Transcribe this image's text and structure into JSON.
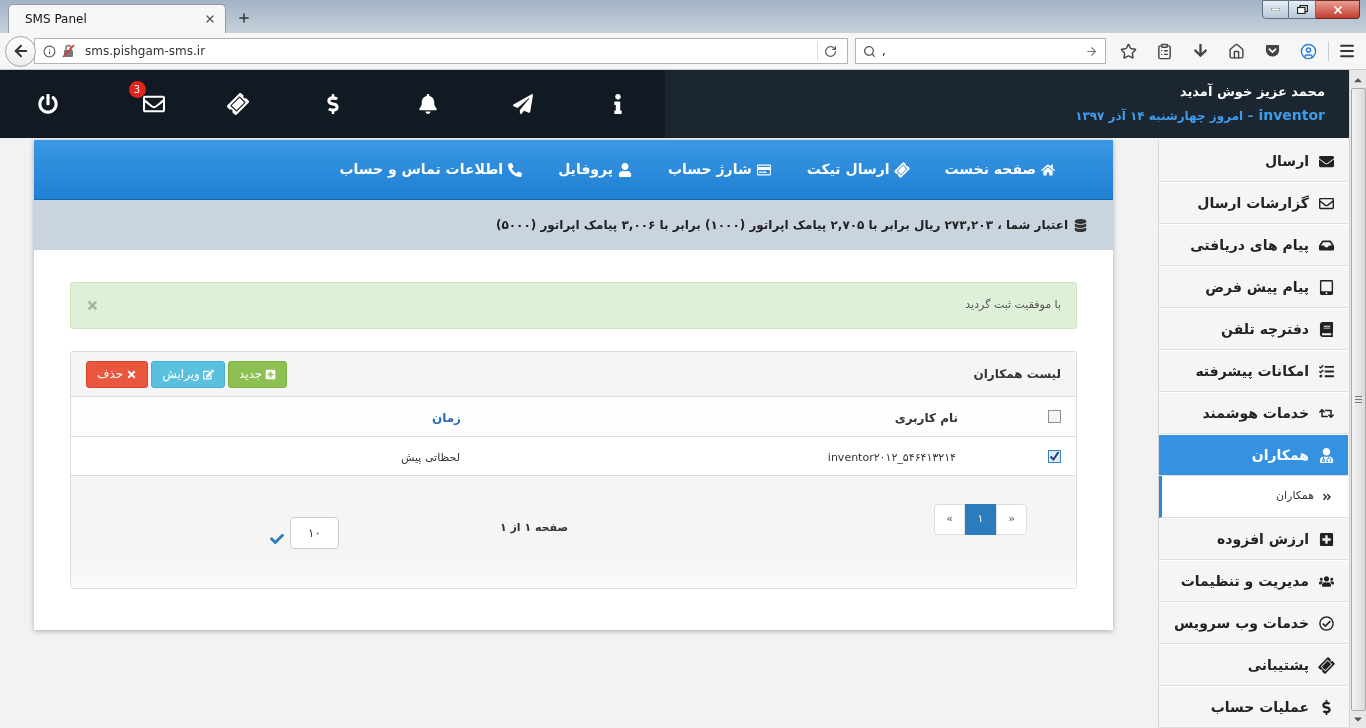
{
  "browser": {
    "tab_title": "SMS Panel",
    "address": "sms.pishgam-sms.ir",
    "search_value": ","
  },
  "header": {
    "welcome": "محمد عزیز خوش آمدید",
    "user": "inventor",
    "date": "– امروز چهارشنبه ۱۴ آذر ۱۳۹۷",
    "mail_badge": "3"
  },
  "nav": [
    {
      "label": "صفحه نخست"
    },
    {
      "label": "ارسال تیکت"
    },
    {
      "label": "شارژ حساب"
    },
    {
      "label": "پروفایل"
    },
    {
      "label": "اطلاعات تماس و حساب"
    }
  ],
  "credit": "اعتبار شما ، ۲۷۳,۲۰۳ ریال برابر با ۲,۷۰۵ پیامک اپراتور (۱۰۰۰) برابر با ۳,۰۰۶ پیامک اپراتور (۵۰۰۰)",
  "alert": {
    "message": "با موفقیت ثبت گردید"
  },
  "panel": {
    "title": "لیست همکاران",
    "buttons": [
      {
        "label": "جدید",
        "kind": "new"
      },
      {
        "label": "ویرایش",
        "kind": "edit"
      },
      {
        "label": "حذف",
        "kind": "delete"
      }
    ]
  },
  "table": {
    "select_all": false,
    "columns": [
      {
        "label": "نام کاربری",
        "link": false
      },
      {
        "label": "زمان",
        "link": true
      }
    ],
    "rows": [
      {
        "checked": true,
        "cells": [
          "inventor۲۰۱۲_۵۴۶۴۱۳۲۱۴",
          "لحظاتی پیش"
        ]
      }
    ]
  },
  "pagination": {
    "buttons": [
      {
        "label": "»",
        "selected": false
      },
      {
        "label": "۱",
        "selected": true
      },
      {
        "label": "«",
        "selected": false
      }
    ],
    "info": "صفحه ۱ از ۱",
    "page_size": "۱۰"
  },
  "sidebar": {
    "items": [
      {
        "label": "ارسال",
        "selected": false
      },
      {
        "label": "گزارشات ارسال",
        "selected": false
      },
      {
        "label": "پیام های دریافتی",
        "selected": false
      },
      {
        "label": "پیام پیش فرض",
        "selected": false
      },
      {
        "label": "دفترچه تلفن",
        "selected": false
      },
      {
        "label": "امکانات پیشرفته",
        "selected": false
      },
      {
        "label": "خدمات هوشمند",
        "selected": false
      },
      {
        "label": "همکاران",
        "selected": true,
        "children": [
          {
            "label": "همکاران"
          }
        ]
      },
      {
        "label": "ارزش افزوده",
        "selected": false
      },
      {
        "label": "مدیریت و تنظیمات",
        "selected": false
      },
      {
        "label": "خدمات وب سرویس",
        "selected": false
      },
      {
        "label": "پشتیبانی",
        "selected": false
      },
      {
        "label": "عملیات حساب",
        "selected": false
      }
    ]
  }
}
